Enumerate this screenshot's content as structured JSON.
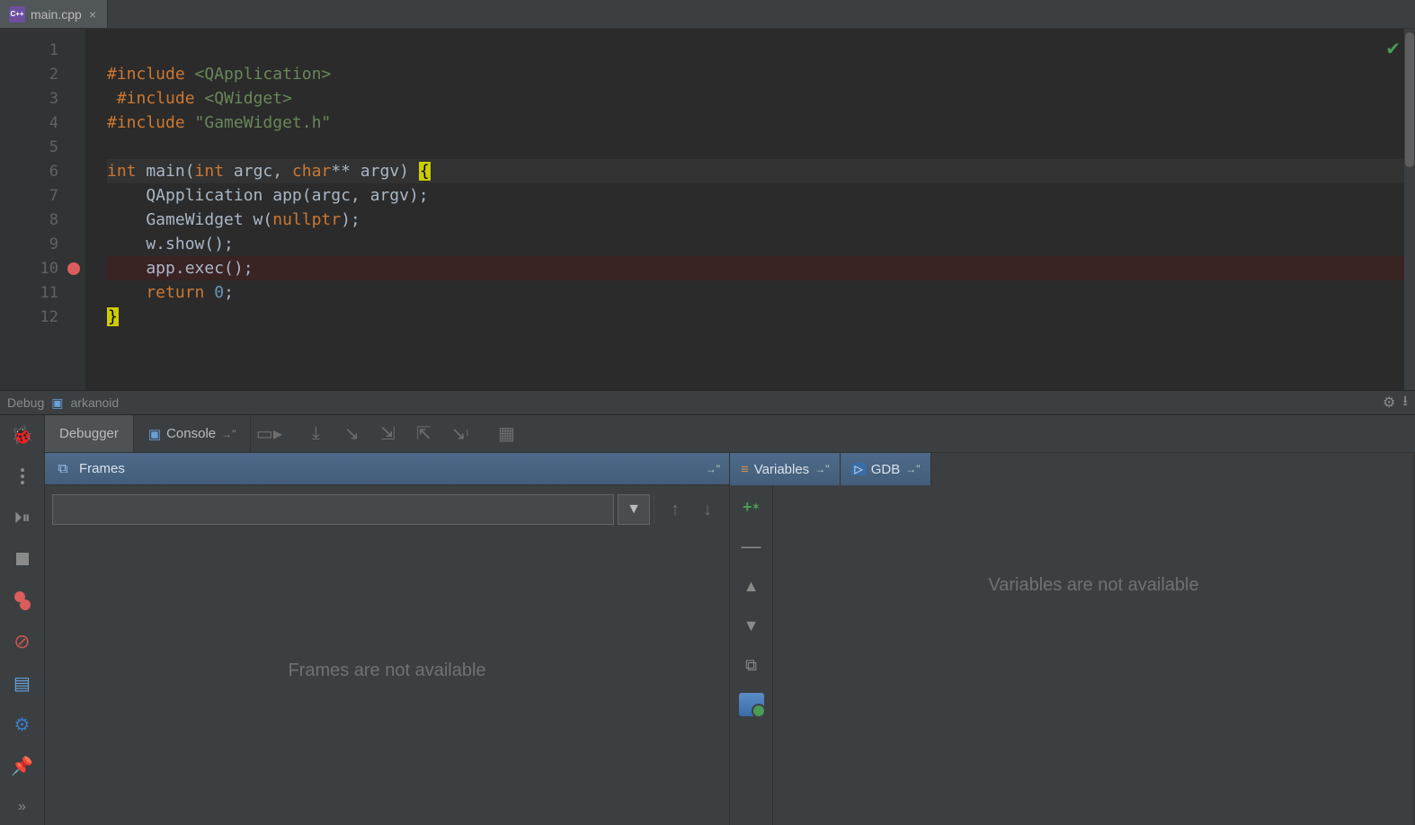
{
  "tab": {
    "filename": "main.cpp"
  },
  "editor": {
    "lines": [
      1,
      2,
      3,
      4,
      5,
      6,
      7,
      8,
      9,
      10,
      11,
      12
    ],
    "breakpoint_line": 10,
    "code": {
      "l2_include": "#include",
      "l2_target": "<QApplication>",
      "l3_include": "#include",
      "l3_target": "<QWidget>",
      "l4_include": "#include",
      "l4_target": "\"GameWidget.h\"",
      "l6_int": "int",
      "l6_main": " main(",
      "l6_int2": "int",
      "l6_argc": " argc, ",
      "l6_char": "char",
      "l6_rest": "** argv) ",
      "l7": "    QApplication app(argc, argv);",
      "l8a": "    GameWidget w(",
      "l8_null": "nullptr",
      "l8b": ");",
      "l9": "    w.show();",
      "l10": "    app.exec();",
      "l11_ret": "    return ",
      "l11_zero": "0",
      "l11_semi": ";",
      "l12": "}"
    }
  },
  "toolwindow": {
    "title": "Debug",
    "config": "arkanoid"
  },
  "dbg": {
    "tab_debugger": "Debugger",
    "tab_console": "Console",
    "frames_title": "Frames",
    "vars_title": "Variables",
    "gdb_title": "GDB",
    "frames_empty": "Frames are not available",
    "vars_empty": "Variables are not available"
  }
}
